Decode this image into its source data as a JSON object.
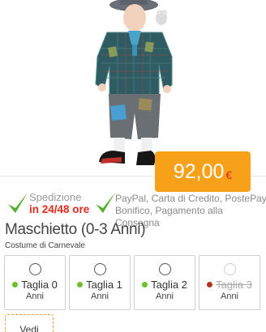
{
  "product": {
    "image_alt": "Bambino in costume da maschietto",
    "price": "92,00",
    "currency": "€"
  },
  "shipping": {
    "line1": "Spedizione",
    "line2": "in 24/48 ore"
  },
  "payment": {
    "text": "PayPal, Carta di Credito, PostePay Bonifico, Pagamento alla Consegna"
  },
  "title": "Maschietto (0-3 Anni)",
  "subtitle": "Costume di Carnevale",
  "sizes": [
    {
      "label": "Taglia 0",
      "unit": "Anni",
      "available": true
    },
    {
      "label": "Taglia 1",
      "unit": "Anni",
      "available": true
    },
    {
      "label": "Taglia 2",
      "unit": "Anni",
      "available": true
    },
    {
      "label": "Taglia 3",
      "unit": "Anni",
      "available": false
    }
  ],
  "colors": {
    "available": "#6cbf2a",
    "unavailable": "#b8321a",
    "price_badge": "#f7a11a",
    "accent_red": "#e32a1a",
    "check_green": "#52ae2c"
  },
  "vedi_button": "Vedi"
}
